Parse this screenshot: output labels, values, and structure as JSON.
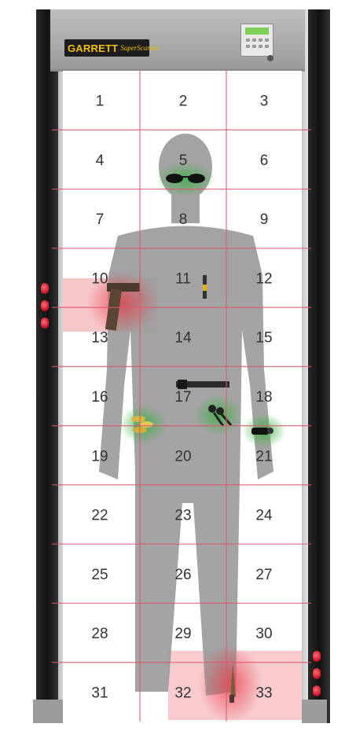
{
  "header": {
    "brand": "GARRETT",
    "brand_script": "SuperScanner"
  },
  "zones": {
    "numbers": [
      "1",
      "2",
      "3",
      "4",
      "5",
      "6",
      "7",
      "8",
      "9",
      "10",
      "11",
      "12",
      "13",
      "14",
      "15",
      "16",
      "17",
      "18",
      "19",
      "20",
      "21",
      "22",
      "23",
      "24",
      "25",
      "26",
      "27",
      "28",
      "29",
      "30",
      "31",
      "32",
      "33"
    ],
    "rows": 11,
    "cols": 3
  },
  "detections": {
    "threat_zones": [
      "13",
      "33"
    ],
    "cleared_zones": [
      "8",
      "20",
      "21"
    ],
    "threat_color": "#e63946",
    "cleared_color": "#3cb043"
  },
  "items": [
    {
      "name": "sunglasses-icon",
      "zone": "8"
    },
    {
      "name": "handgun-icon",
      "zone": "13"
    },
    {
      "name": "pen-icon",
      "zone": "14"
    },
    {
      "name": "belt-buckle-icon",
      "zone": "17"
    },
    {
      "name": "coins-icon",
      "zone": "20"
    },
    {
      "name": "keys-icon",
      "zone": "20"
    },
    {
      "name": "wristwatch-icon",
      "zone": "21"
    },
    {
      "name": "knife-icon",
      "zone": "32"
    }
  ],
  "colors": {
    "grid_line": "#e0566b",
    "zone_text": "#333333",
    "silhouette": "#9a9a9a",
    "frame_dark": "#1a1a1a",
    "brand_yellow": "#f2c200",
    "led_red": "#c8102e"
  }
}
